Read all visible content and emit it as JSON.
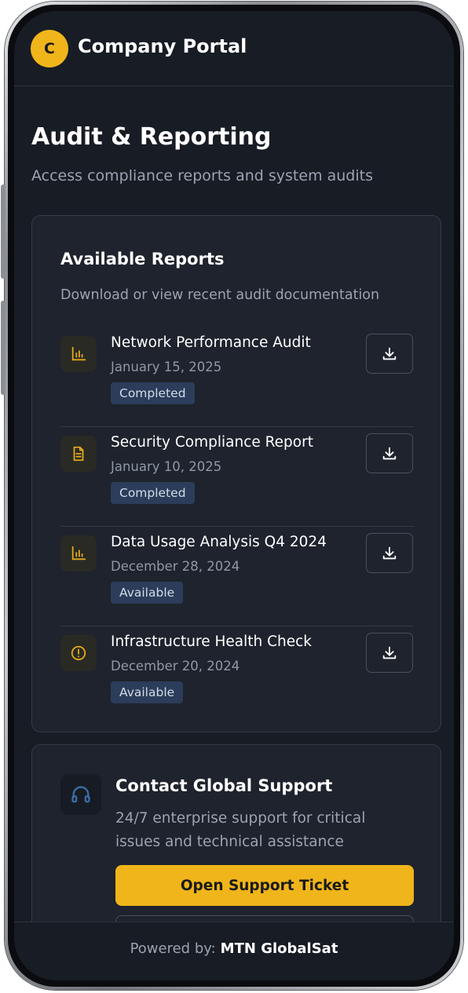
{
  "app": {
    "logo_letter": "C",
    "title": "Company Portal"
  },
  "page": {
    "title": "Audit & Reporting",
    "subtitle": "Access compliance reports and system audits"
  },
  "reports_card": {
    "title": "Available Reports",
    "subtitle": "Download or view recent audit documentation",
    "items": [
      {
        "name": "Network Performance Audit",
        "date": "January 15, 2025",
        "status": "Completed",
        "icon": "bar-chart-icon"
      },
      {
        "name": "Security Compliance Report",
        "date": "January 10, 2025",
        "status": "Completed",
        "icon": "document-icon"
      },
      {
        "name": "Data Usage Analysis Q4 2024",
        "date": "December 28, 2024",
        "status": "Available",
        "icon": "bar-chart-icon"
      },
      {
        "name": "Infrastructure Health Check",
        "date": "December 20, 2024",
        "status": "Available",
        "icon": "alert-circle-icon"
      }
    ]
  },
  "support_card": {
    "title": "Contact Global Support",
    "text": "24/7 enterprise support for critical issues and technical assistance",
    "primary_button": "Open Support Ticket"
  },
  "footer": {
    "label": "Powered by:",
    "brand": "MTN GlobalSat"
  },
  "colors": {
    "accent": "#f0b51a",
    "background": "#181c24",
    "card": "#1e232d",
    "badge": "#2b3d5a"
  }
}
